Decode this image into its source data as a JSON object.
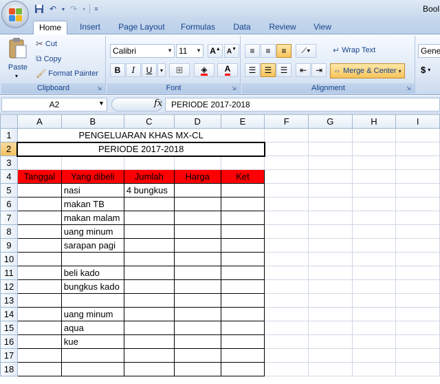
{
  "title_bar": {
    "title": "Bool"
  },
  "quick_access": {
    "save_icon": "save-icon",
    "undo_icon": "undo-icon",
    "redo_icon": "redo-icon",
    "customize_icon": "customize-icon"
  },
  "tabs": [
    "Home",
    "Insert",
    "Page Layout",
    "Formulas",
    "Data",
    "Review",
    "View"
  ],
  "ribbon": {
    "clipboard": {
      "paste": "Paste",
      "cut": "Cut",
      "copy": "Copy",
      "format_painter": "Format Painter",
      "label": "Clipboard"
    },
    "font": {
      "font_name": "Calibri",
      "font_size": "11",
      "label": "Font",
      "bold": "B",
      "italic": "I",
      "underline": "U"
    },
    "alignment": {
      "wrap_text": "Wrap Text",
      "merge_center": "Merge & Center",
      "label": "Alignment"
    },
    "number": {
      "format": "Gene",
      "currency": "$"
    }
  },
  "formula_bar": {
    "name_box": "A2",
    "fx": "fx",
    "content": "PERIODE 2017-2018"
  },
  "sheet": {
    "columns": [
      "A",
      "B",
      "C",
      "D",
      "E",
      "F",
      "G",
      "H",
      "I"
    ],
    "rows": [
      "1",
      "2",
      "3",
      "4",
      "5",
      "6",
      "7",
      "8",
      "9",
      "10",
      "11",
      "12",
      "13",
      "14",
      "15",
      "16",
      "17",
      "18"
    ],
    "title": "PENGELUARAN KHAS MX-CL",
    "period": "PERIODE 2017-2018",
    "headers": [
      "Tanggal",
      "Yang dibeli",
      "Jumlah",
      "Harga",
      "Ket"
    ],
    "items": [
      "nasi",
      "makan TB",
      "makan malam",
      "uang minum",
      "sarapan pagi",
      "",
      "beli kado",
      "bungkus kado",
      "",
      "uang minum",
      "aqua",
      "kue",
      "",
      ""
    ],
    "jumlah_row5": "4 bungkus"
  },
  "colors": {
    "header_fill": "#ff0000",
    "ribbon_blue": "#15428b"
  }
}
